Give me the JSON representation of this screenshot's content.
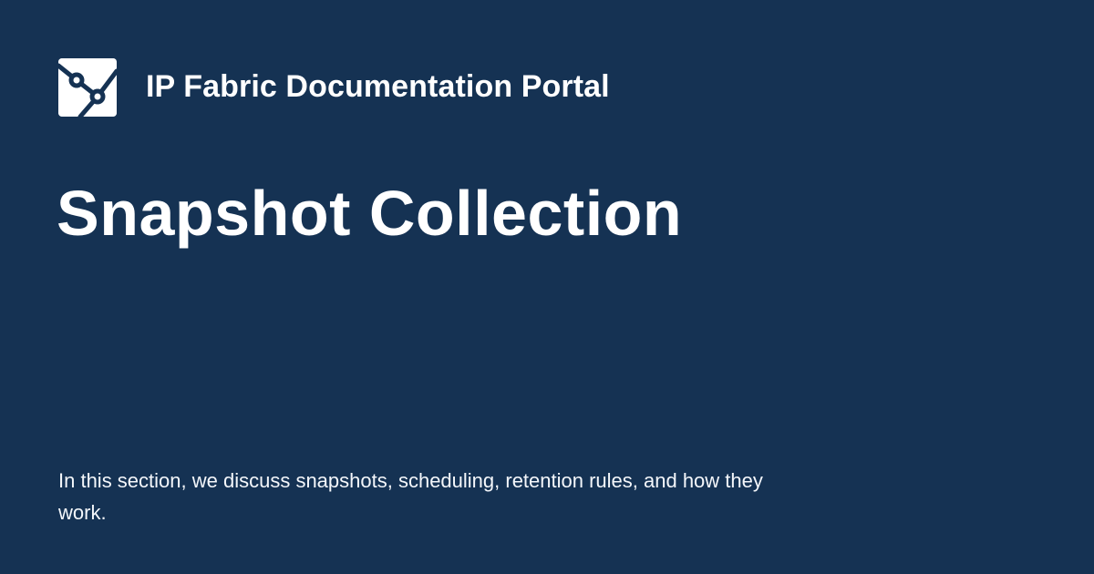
{
  "header": {
    "site_name": "IP Fabric Documentation Portal",
    "logo_icon": "ip-fabric-logo-icon"
  },
  "page": {
    "title": "Snapshot Collection",
    "description": "In this section, we discuss snapshots, scheduling, retention rules, and how they work."
  },
  "colors": {
    "background": "#153253",
    "text": "#ffffff",
    "logo_background": "#ffffff"
  }
}
